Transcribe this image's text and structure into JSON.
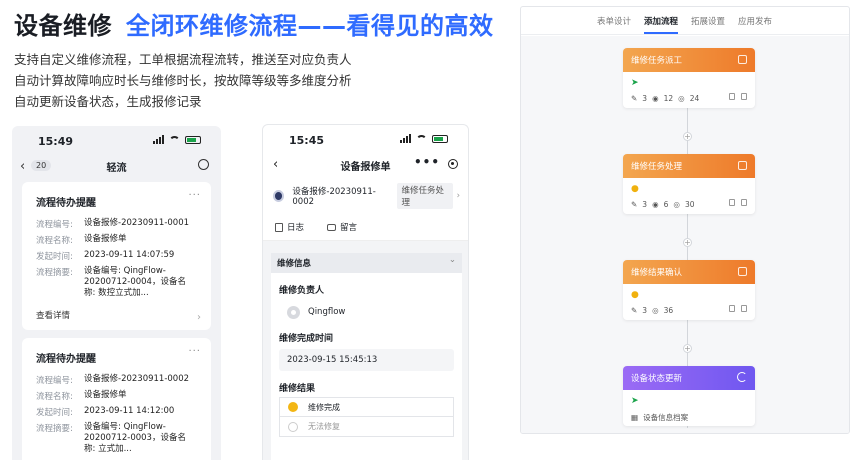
{
  "headline": {
    "part1": "设备维修",
    "part2": "全闭环维修流程——看得见的高效"
  },
  "description": [
    "支持自定义维修流程，工单根据流程流转，推送至对应负责人",
    "自动计算故障响应时长与维修时长，按故障等级等多维度分析",
    "自动更新设备状态，生成报修记录"
  ],
  "phone1": {
    "time": "15:49",
    "back_badge": "20",
    "title": "轻流",
    "cards": [
      {
        "title": "流程待办提醒",
        "more": "···",
        "rows": [
          {
            "key": "流程编号:",
            "value": "设备报修-20230911-0001"
          },
          {
            "key": "流程名称:",
            "value": "设备报修单"
          },
          {
            "key": "发起时间:",
            "value": "2023-09-11 14:07:59"
          },
          {
            "key": "流程摘要:",
            "value": "设备编号: QingFlow-20200712-0004，设备名称: 数控立式加..."
          }
        ],
        "link": "查看详情"
      },
      {
        "title": "流程待办提醒",
        "more": "···",
        "rows": [
          {
            "key": "流程编号:",
            "value": "设备报修-20230911-0002"
          },
          {
            "key": "流程名称:",
            "value": "设备报修单"
          },
          {
            "key": "发起时间:",
            "value": "2023-09-11 14:12:00"
          },
          {
            "key": "流程摘要:",
            "value": "设备编号: QingFlow-20200712-0003，设备名称: 立式加..."
          }
        ]
      }
    ]
  },
  "phone2": {
    "time": "15:45",
    "title": "设备报修单",
    "more": "•••",
    "record_id": "设备报修-20230911-0002",
    "record_stage": "维修任务处理",
    "tabs": [
      "日志",
      "留言"
    ],
    "section": "维修信息",
    "fields": {
      "owner_label": "维修负责人",
      "owner_value": "Qingflow",
      "done_label": "维修完成时间",
      "done_value": "2023-09-15 15:45:13",
      "result_label": "维修结果",
      "options": [
        "维修完成",
        "无法修复"
      ]
    }
  },
  "workflow": {
    "tabs": [
      "表单设计",
      "添加流程",
      "拓展设置",
      "应用发布"
    ],
    "active_tab": "添加流程",
    "nodes": [
      {
        "title": "维修任务派工",
        "color": "orange",
        "icon": "send-icon",
        "stats": [
          "3",
          "12",
          "24"
        ]
      },
      {
        "title": "维修任务处理",
        "color": "orange",
        "icon": "user-icon",
        "stats": [
          "3",
          "6",
          "30"
        ]
      },
      {
        "title": "维修结果确认",
        "color": "orange",
        "icon": "user-icon",
        "stats": [
          "3",
          "36"
        ]
      },
      {
        "title": "设备状态更新",
        "color": "purple",
        "icon": "send-icon",
        "sub": "设备信息档案"
      }
    ]
  },
  "colors": {
    "accent_blue": "#2f6bff",
    "orange": "#ee7a2a",
    "purple": "#6f57f0"
  }
}
